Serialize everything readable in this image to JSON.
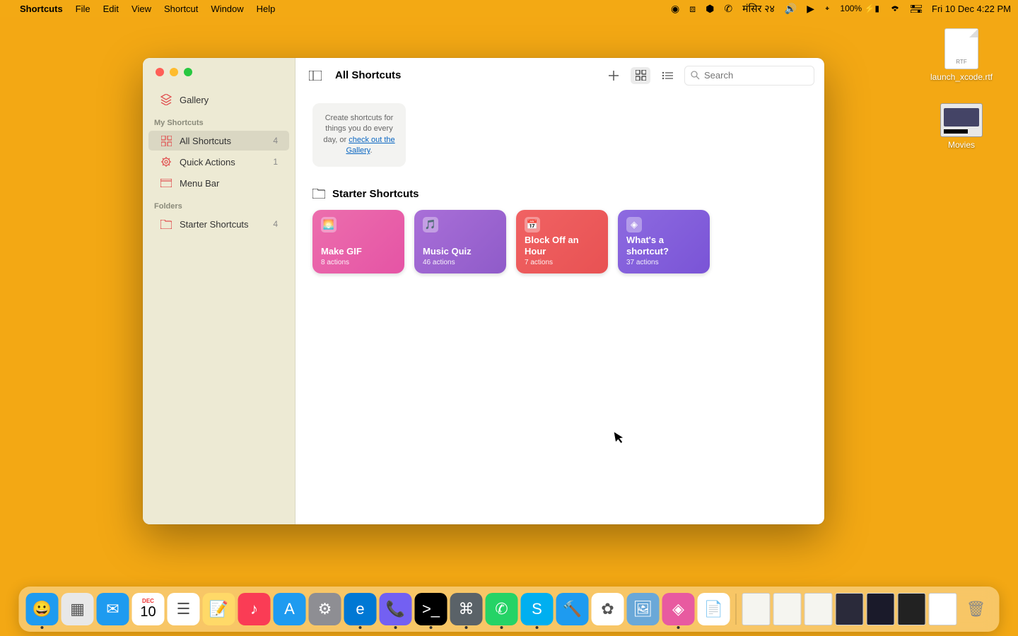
{
  "menubar": {
    "app": "Shortcuts",
    "items": [
      "File",
      "Edit",
      "View",
      "Shortcut",
      "Window",
      "Help"
    ],
    "date_alt": "मंसिर २४",
    "battery": "100%",
    "clock": "Fri 10 Dec  4:22 PM"
  },
  "desktop": {
    "file1": "launch_xcode.rtf",
    "folder1": "Movies"
  },
  "window": {
    "title": "All Shortcuts",
    "search_placeholder": "Search",
    "hint_prefix": "Create shortcuts for things you do every day, or ",
    "hint_link": "check out the Gallery",
    "section": "Starter Shortcuts"
  },
  "sidebar": {
    "gallery": "Gallery",
    "header1": "My Shortcuts",
    "all": {
      "label": "All Shortcuts",
      "count": "4"
    },
    "quick": {
      "label": "Quick Actions",
      "count": "1"
    },
    "menubar": {
      "label": "Menu Bar"
    },
    "header2": "Folders",
    "starter": {
      "label": "Starter Shortcuts",
      "count": "4"
    }
  },
  "cards": [
    {
      "title": "Make GIF",
      "sub": "8 actions",
      "color": "linear-gradient(135deg,#ec6ead,#e554a5)",
      "icon": "🌅"
    },
    {
      "title": "Music Quiz",
      "sub": "46 actions",
      "color": "linear-gradient(135deg,#a96fd8,#8f5bc9)",
      "icon": "🎵"
    },
    {
      "title": "Block Off an Hour",
      "sub": "7 actions",
      "color": "linear-gradient(135deg,#f06263,#e85253)",
      "icon": "📅"
    },
    {
      "title": "What's a shortcut?",
      "sub": "37 actions",
      "color": "linear-gradient(135deg,#8d6ae0,#7a54d6)",
      "icon": "◈"
    }
  ],
  "dock": {
    "apps": [
      {
        "name": "finder",
        "color": "#1e9bf0",
        "glyph": "😀",
        "running": true
      },
      {
        "name": "launchpad",
        "color": "#e8e8e8",
        "glyph": "▦",
        "running": false
      },
      {
        "name": "mail",
        "color": "#1e9bf0",
        "glyph": "✉",
        "running": false
      },
      {
        "name": "calendar",
        "color": "#fff",
        "glyph": "10",
        "running": false
      },
      {
        "name": "reminders",
        "color": "#fff",
        "glyph": "☰",
        "running": false
      },
      {
        "name": "notes",
        "color": "#ffd968",
        "glyph": "📝",
        "running": false
      },
      {
        "name": "music",
        "color": "#fa3c55",
        "glyph": "♪",
        "running": false
      },
      {
        "name": "appstore",
        "color": "#1e9bf0",
        "glyph": "A",
        "running": false
      },
      {
        "name": "settings",
        "color": "#8e8e93",
        "glyph": "⚙",
        "running": false
      },
      {
        "name": "edge",
        "color": "#0078d4",
        "glyph": "e",
        "running": true
      },
      {
        "name": "viber",
        "color": "#7360f2",
        "glyph": "📞",
        "running": true
      },
      {
        "name": "terminal",
        "color": "#000",
        "glyph": ">_",
        "running": true
      },
      {
        "name": "screenshot",
        "color": "#5a6268",
        "glyph": "⌘",
        "running": true
      },
      {
        "name": "whatsapp",
        "color": "#25d366",
        "glyph": "✆",
        "running": true
      },
      {
        "name": "skype",
        "color": "#00aff0",
        "glyph": "S",
        "running": true
      },
      {
        "name": "xcode",
        "color": "#1e9bf0",
        "glyph": "🔨",
        "running": false
      },
      {
        "name": "photos",
        "color": "#fff",
        "glyph": "✿",
        "running": false
      },
      {
        "name": "preview",
        "color": "#6aa8d8",
        "glyph": "🖼",
        "running": false
      },
      {
        "name": "shortcuts",
        "color": "#e85aa0",
        "glyph": "◈",
        "running": true
      },
      {
        "name": "textedit",
        "color": "#fff",
        "glyph": "📄",
        "running": false
      }
    ],
    "cal_month": "DEC",
    "cal_day": "10"
  }
}
